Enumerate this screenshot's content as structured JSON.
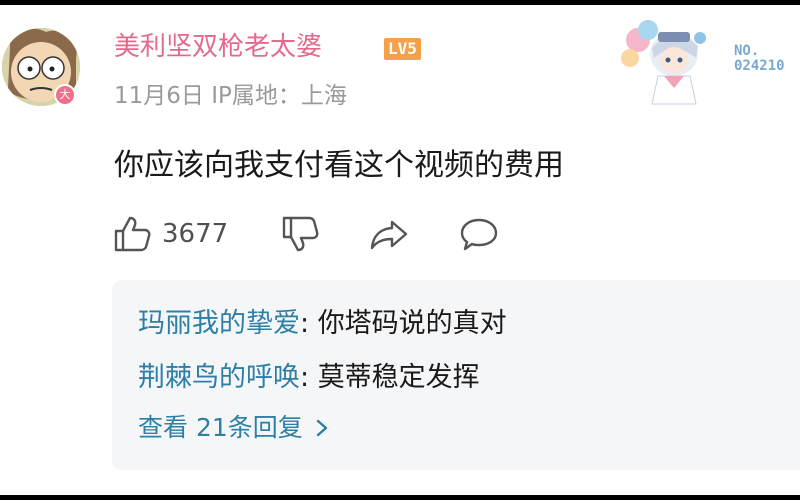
{
  "comment": {
    "author": {
      "name": "美利坚双枪老太婆",
      "level": "LV5",
      "avatar_badge": "大"
    },
    "meta": "11月6日 IP属地：上海",
    "fan_card": {
      "no_label": "NO.",
      "number": "024210"
    },
    "text": "你应该向我支付看这个视频的费用",
    "actions": {
      "like_count": "3677",
      "icons": [
        "thumbs-up-icon",
        "thumbs-down-icon",
        "share-icon",
        "reply-icon"
      ]
    },
    "replies": [
      {
        "user": "玛丽我的挚爱",
        "separator": ": ",
        "text": "你塔码说的真对"
      },
      {
        "user": "荆棘鸟的呼唤",
        "separator": ": ",
        "text": "莫蒂稳定发挥"
      }
    ],
    "view_more": "查看 21条回复"
  },
  "colors": {
    "username": "#e46a8c",
    "level_badge": "#f5a04a",
    "reply_user": "#2e7fa6",
    "meta": "#9a9a9a",
    "reply_panel": "#f5f6f8"
  }
}
